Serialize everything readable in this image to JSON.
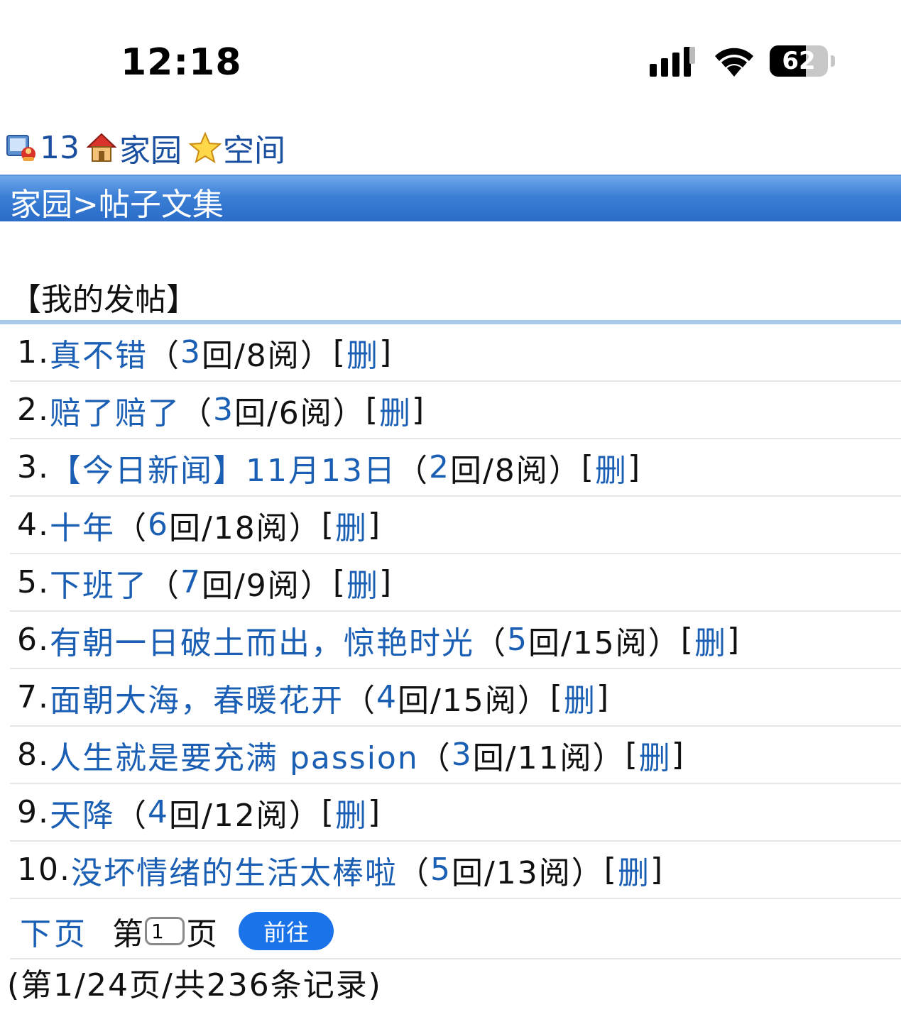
{
  "status_bar": {
    "time": "12:18",
    "battery_percent": "62",
    "battery_level": 0.62,
    "icons": [
      "cellular-signal-icon",
      "wifi-icon",
      "battery-icon"
    ]
  },
  "top_nav": {
    "user_count": "13",
    "home_label": "家园",
    "space_label": "空间"
  },
  "title_bar": {
    "breadcrumb": "家园>帖子文集"
  },
  "section": {
    "title": "【我的发帖】"
  },
  "posts": [
    {
      "num": "1.",
      "title": "真不错",
      "open": "（",
      "replies": "3",
      "reads": "回/8阅）",
      "delete_open": "[",
      "delete_label": "删",
      "delete_close": "]"
    },
    {
      "num": "2.",
      "title": "赔了赔了",
      "open": "（",
      "replies": "3",
      "reads": "回/6阅）",
      "delete_open": "[",
      "delete_label": "删",
      "delete_close": "]"
    },
    {
      "num": "3.",
      "title": "【今日新闻】11月13日",
      "open": "（",
      "replies": "2",
      "reads": "回/8阅）",
      "delete_open": "[",
      "delete_label": "删",
      "delete_close": "]"
    },
    {
      "num": "4.",
      "title": "十年",
      "open": "（",
      "replies": "6",
      "reads": "回/18阅）",
      "delete_open": "[",
      "delete_label": "删",
      "delete_close": "]"
    },
    {
      "num": "5.",
      "title": "下班了",
      "open": "（",
      "replies": "7",
      "reads": "回/9阅）",
      "delete_open": "[",
      "delete_label": "删",
      "delete_close": "]"
    },
    {
      "num": "6.",
      "title": "有朝一日破土而出，惊艳时光",
      "open": "（",
      "replies": "5",
      "reads": "回/15阅）",
      "delete_open": "[",
      "delete_label": "删",
      "delete_close": "]"
    },
    {
      "num": "7.",
      "title": "面朝大海，春暖花开",
      "open": "（",
      "replies": "4",
      "reads": "回/15阅）",
      "delete_open": "[",
      "delete_label": "删",
      "delete_close": "]"
    },
    {
      "num": "8.",
      "title": "人生就是要充满 passion",
      "open": "（",
      "replies": "3",
      "reads": "回/11阅）",
      "delete_open": "[",
      "delete_label": "删",
      "delete_close": "]"
    },
    {
      "num": "9.",
      "title": "天降",
      "open": "（",
      "replies": "4",
      "reads": "回/12阅）",
      "delete_open": "[",
      "delete_label": "删",
      "delete_close": "]"
    },
    {
      "num": "10.",
      "title": "没坏情绪的生活太棒啦",
      "open": "（",
      "replies": "5",
      "reads": "回/13阅）",
      "delete_open": "[",
      "delete_label": "删",
      "delete_close": "]"
    }
  ],
  "pager": {
    "next_label": "下页",
    "page_prefix": "第",
    "page_value": "1",
    "page_suffix": "页",
    "go_label": "前往",
    "summary": "(第1/24页/共236条记录)"
  },
  "colors": {
    "link": "#1a5fb4",
    "title_bar": "#2a6cc8",
    "go_button": "#1a73e8",
    "section_rule": "#a8c8ec"
  }
}
